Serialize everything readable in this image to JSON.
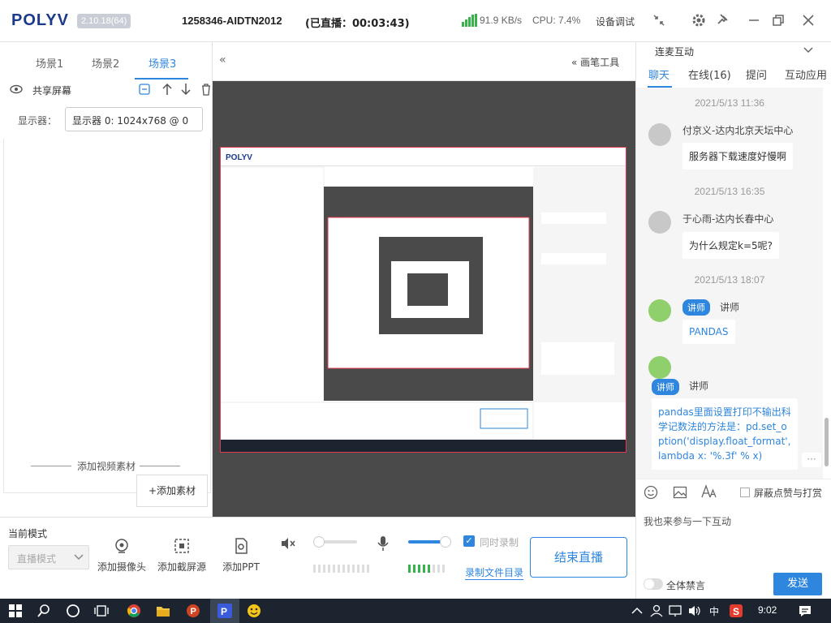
{
  "app": {
    "logo": "POLYV",
    "version": "2.10.18(64)",
    "room_id": "1258346-AIDTN2012",
    "live_status": "(已直播：00:03:43)",
    "net_speed": "91.9 KB/s",
    "cpu": "CPU: 7.4%",
    "debug_label": "设备调试"
  },
  "left": {
    "scenes": [
      "场景1",
      "场景2",
      "场景3"
    ],
    "active_scene": "场景3",
    "source_label": "共享屏幕",
    "display_label": "显示器：",
    "display_value": "显示器 0: 1024x768 @ 0",
    "add_video_label": "添加视频素材",
    "add_material_label": "+添加素材"
  },
  "center": {
    "collapse_glyph": "«",
    "pen_tools_label": "« 画笔工具"
  },
  "bottom": {
    "mode_label": "当前模式",
    "mode_value": "直播模式",
    "add_camera": "添加摄像头",
    "add_screen": "添加截屏源",
    "add_ppt": "添加PPT",
    "sync_record": "同时录制",
    "record_dir": "录制文件目录",
    "end_live": "结束直播"
  },
  "right": {
    "mic_linked": "连麦互动",
    "tabs": [
      "聊天",
      "在线(16)",
      "提问",
      "互动应用"
    ],
    "active_tab": "聊天",
    "messages": [
      {
        "time": "2021/5/13 11:36",
        "user": "付京义-达内北京天坛中心",
        "text": "服务器下载速度好慢啊",
        "teacher": false
      },
      {
        "time": "2021/5/13 16:35",
        "user": "于心雨-达内长春中心",
        "text": "为什么规定k=5呢?",
        "teacher": false
      },
      {
        "time": "2021/5/13 18:07",
        "user": "讲师",
        "badge": "讲师",
        "text": "PANDAS",
        "teacher": true
      },
      {
        "time": "",
        "user": "讲师",
        "badge": "讲师",
        "text": "pandas里面设置打印不输出科学记数法的方法是：pd.set_option('display.float_format',lambda x: '%.3f' % x)",
        "teacher": true
      }
    ],
    "block_label": "屏蔽点赞与打赏",
    "input_placeholder": "我也来参与一下互动",
    "mute_label": "全体禁言",
    "send_label": "发送"
  },
  "taskbar": {
    "ime": "中",
    "clock": "9:02"
  },
  "colors": {
    "accent": "#2e86de",
    "capture_border": "#e33b4d",
    "meter_on": "#38b24a"
  }
}
